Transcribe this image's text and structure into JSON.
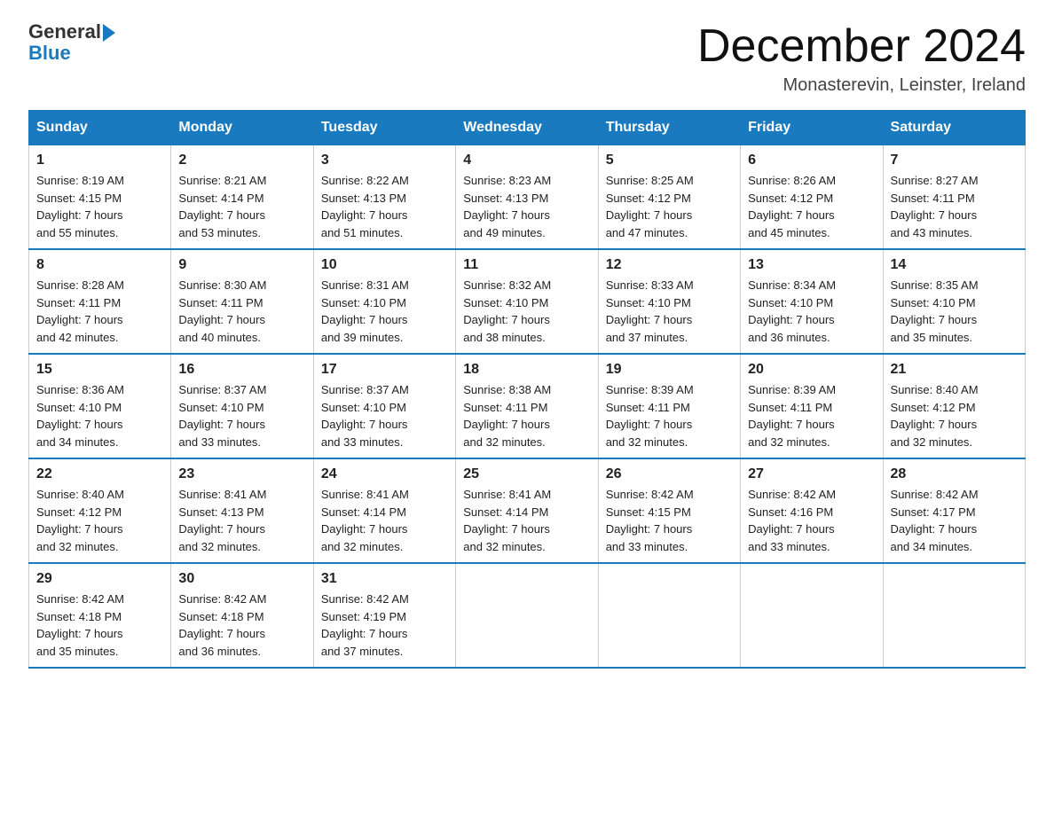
{
  "header": {
    "logo_line1": "General",
    "logo_line2": "Blue",
    "month_title": "December 2024",
    "location": "Monasterevin, Leinster, Ireland"
  },
  "days_of_week": [
    "Sunday",
    "Monday",
    "Tuesday",
    "Wednesday",
    "Thursday",
    "Friday",
    "Saturday"
  ],
  "weeks": [
    [
      {
        "day": "1",
        "info": "Sunrise: 8:19 AM\nSunset: 4:15 PM\nDaylight: 7 hours\nand 55 minutes."
      },
      {
        "day": "2",
        "info": "Sunrise: 8:21 AM\nSunset: 4:14 PM\nDaylight: 7 hours\nand 53 minutes."
      },
      {
        "day": "3",
        "info": "Sunrise: 8:22 AM\nSunset: 4:13 PM\nDaylight: 7 hours\nand 51 minutes."
      },
      {
        "day": "4",
        "info": "Sunrise: 8:23 AM\nSunset: 4:13 PM\nDaylight: 7 hours\nand 49 minutes."
      },
      {
        "day": "5",
        "info": "Sunrise: 8:25 AM\nSunset: 4:12 PM\nDaylight: 7 hours\nand 47 minutes."
      },
      {
        "day": "6",
        "info": "Sunrise: 8:26 AM\nSunset: 4:12 PM\nDaylight: 7 hours\nand 45 minutes."
      },
      {
        "day": "7",
        "info": "Sunrise: 8:27 AM\nSunset: 4:11 PM\nDaylight: 7 hours\nand 43 minutes."
      }
    ],
    [
      {
        "day": "8",
        "info": "Sunrise: 8:28 AM\nSunset: 4:11 PM\nDaylight: 7 hours\nand 42 minutes."
      },
      {
        "day": "9",
        "info": "Sunrise: 8:30 AM\nSunset: 4:11 PM\nDaylight: 7 hours\nand 40 minutes."
      },
      {
        "day": "10",
        "info": "Sunrise: 8:31 AM\nSunset: 4:10 PM\nDaylight: 7 hours\nand 39 minutes."
      },
      {
        "day": "11",
        "info": "Sunrise: 8:32 AM\nSunset: 4:10 PM\nDaylight: 7 hours\nand 38 minutes."
      },
      {
        "day": "12",
        "info": "Sunrise: 8:33 AM\nSunset: 4:10 PM\nDaylight: 7 hours\nand 37 minutes."
      },
      {
        "day": "13",
        "info": "Sunrise: 8:34 AM\nSunset: 4:10 PM\nDaylight: 7 hours\nand 36 minutes."
      },
      {
        "day": "14",
        "info": "Sunrise: 8:35 AM\nSunset: 4:10 PM\nDaylight: 7 hours\nand 35 minutes."
      }
    ],
    [
      {
        "day": "15",
        "info": "Sunrise: 8:36 AM\nSunset: 4:10 PM\nDaylight: 7 hours\nand 34 minutes."
      },
      {
        "day": "16",
        "info": "Sunrise: 8:37 AM\nSunset: 4:10 PM\nDaylight: 7 hours\nand 33 minutes."
      },
      {
        "day": "17",
        "info": "Sunrise: 8:37 AM\nSunset: 4:10 PM\nDaylight: 7 hours\nand 33 minutes."
      },
      {
        "day": "18",
        "info": "Sunrise: 8:38 AM\nSunset: 4:11 PM\nDaylight: 7 hours\nand 32 minutes."
      },
      {
        "day": "19",
        "info": "Sunrise: 8:39 AM\nSunset: 4:11 PM\nDaylight: 7 hours\nand 32 minutes."
      },
      {
        "day": "20",
        "info": "Sunrise: 8:39 AM\nSunset: 4:11 PM\nDaylight: 7 hours\nand 32 minutes."
      },
      {
        "day": "21",
        "info": "Sunrise: 8:40 AM\nSunset: 4:12 PM\nDaylight: 7 hours\nand 32 minutes."
      }
    ],
    [
      {
        "day": "22",
        "info": "Sunrise: 8:40 AM\nSunset: 4:12 PM\nDaylight: 7 hours\nand 32 minutes."
      },
      {
        "day": "23",
        "info": "Sunrise: 8:41 AM\nSunset: 4:13 PM\nDaylight: 7 hours\nand 32 minutes."
      },
      {
        "day": "24",
        "info": "Sunrise: 8:41 AM\nSunset: 4:14 PM\nDaylight: 7 hours\nand 32 minutes."
      },
      {
        "day": "25",
        "info": "Sunrise: 8:41 AM\nSunset: 4:14 PM\nDaylight: 7 hours\nand 32 minutes."
      },
      {
        "day": "26",
        "info": "Sunrise: 8:42 AM\nSunset: 4:15 PM\nDaylight: 7 hours\nand 33 minutes."
      },
      {
        "day": "27",
        "info": "Sunrise: 8:42 AM\nSunset: 4:16 PM\nDaylight: 7 hours\nand 33 minutes."
      },
      {
        "day": "28",
        "info": "Sunrise: 8:42 AM\nSunset: 4:17 PM\nDaylight: 7 hours\nand 34 minutes."
      }
    ],
    [
      {
        "day": "29",
        "info": "Sunrise: 8:42 AM\nSunset: 4:18 PM\nDaylight: 7 hours\nand 35 minutes."
      },
      {
        "day": "30",
        "info": "Sunrise: 8:42 AM\nSunset: 4:18 PM\nDaylight: 7 hours\nand 36 minutes."
      },
      {
        "day": "31",
        "info": "Sunrise: 8:42 AM\nSunset: 4:19 PM\nDaylight: 7 hours\nand 37 minutes."
      },
      {
        "day": "",
        "info": ""
      },
      {
        "day": "",
        "info": ""
      },
      {
        "day": "",
        "info": ""
      },
      {
        "day": "",
        "info": ""
      }
    ]
  ]
}
